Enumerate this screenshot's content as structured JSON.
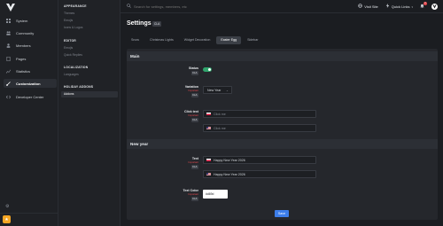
{
  "sidebar": {
    "items": [
      {
        "label": "System",
        "icon": "grid-icon"
      },
      {
        "label": "Community",
        "icon": "users-icon"
      },
      {
        "label": "Members",
        "icon": "user-icon"
      },
      {
        "label": "Pages",
        "icon": "file-icon"
      },
      {
        "label": "Statistics",
        "icon": "chart-icon"
      },
      {
        "label": "Customization",
        "icon": "brush-icon"
      },
      {
        "label": "Developer Center",
        "icon": "code-icon"
      }
    ],
    "active_item": "Customization"
  },
  "submenu": {
    "sections": [
      {
        "title": "APPEARANCE",
        "items": [
          "Themes",
          "Emojis",
          "Icons & Logos"
        ]
      },
      {
        "title": "EDITOR",
        "items": [
          "Emojis",
          "Quick Replies"
        ]
      },
      {
        "title": "LOCALIZATION",
        "items": [
          "Languages"
        ]
      },
      {
        "title": "HOLIDAY ADDONS",
        "items": [
          "Addons"
        ]
      }
    ],
    "active_item": "Addons"
  },
  "topbar": {
    "search_placeholder": "Search for settings, members, etc",
    "visit_site": "Visit Site",
    "quick_links": "Quick Links",
    "notification_count": "1"
  },
  "page": {
    "title": "Settings",
    "version": "CLA"
  },
  "tabs": [
    {
      "label": "Snow",
      "active": false
    },
    {
      "label": "Christmas Lights",
      "active": false
    },
    {
      "label": "Widget Decoration",
      "active": false
    },
    {
      "label": "Easter Egg",
      "active": true
    },
    {
      "label": "Sidebar",
      "active": false
    }
  ],
  "sections": {
    "main": "Main",
    "new_year": "New year"
  },
  "fields": {
    "status": {
      "label": "Status",
      "chip": "CLA",
      "value": true
    },
    "variation": {
      "label": "Variation",
      "scope": "Important",
      "chip": "CLA",
      "value": "New Year"
    },
    "click_text": {
      "label": "Click text",
      "scope": "Important",
      "chip": "CLA",
      "pl_placeholder": "Click me",
      "en_placeholder": "Click me"
    },
    "text": {
      "label": "Text",
      "scope": "Important",
      "chip": "CLA",
      "pl_value": "Happy New Year 2026",
      "en_value": "Happy New Year 2026"
    },
    "text_color": {
      "label": "Text Color",
      "scope": "Important",
      "chip": "CLA",
      "value": "#d69d"
    }
  },
  "save_label": "Save",
  "colors": {
    "accent": "#3d7eea",
    "toggle_on": "#30a46c",
    "important": "#e5484d",
    "background": "#1b1d21"
  }
}
